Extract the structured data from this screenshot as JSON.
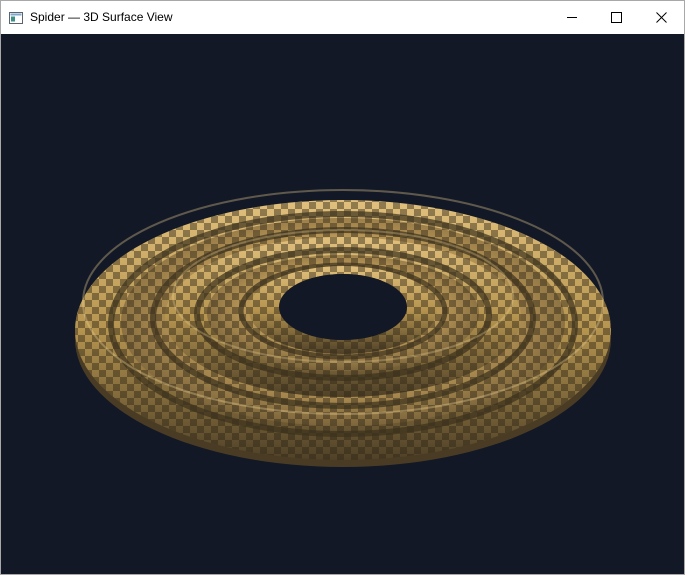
{
  "window": {
    "title": "Spider — 3D Surface View",
    "icons": {
      "app": "app-window-icon",
      "minimize": "minimize-icon",
      "maximize": "maximize-icon",
      "close": "close-icon"
    }
  },
  "viewport": {
    "background": "#121826",
    "object": "concentric-ring-surface",
    "surface_color": "#d8b46e",
    "shadow_color": "#3a2f1e"
  }
}
